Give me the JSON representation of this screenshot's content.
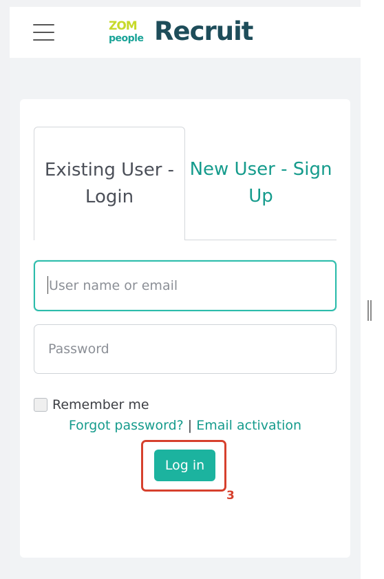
{
  "header": {
    "menu_icon": "hamburger-icon",
    "logo_mark_top": "ZOM",
    "logo_mark_bottom": "people",
    "logo_word": "Recruit"
  },
  "tabs": {
    "login_label": "Existing User - Login",
    "signup_label": "New User - Sign Up"
  },
  "form": {
    "username_placeholder": "User name or email",
    "username_value": "",
    "password_placeholder": "Password",
    "password_value": "",
    "remember_label": "Remember me",
    "remember_checked": false,
    "forgot_link": "Forgot password?",
    "link_separator": "|",
    "activation_link": "Email activation",
    "login_button": "Log in"
  },
  "annotation": {
    "marker_number": "3"
  },
  "colors": {
    "accent": "#1cb39f",
    "link": "#159b8c",
    "brand_dark": "#1e4d5a",
    "brand_lime": "#c7d92a",
    "annotation_red": "#d6402d"
  }
}
